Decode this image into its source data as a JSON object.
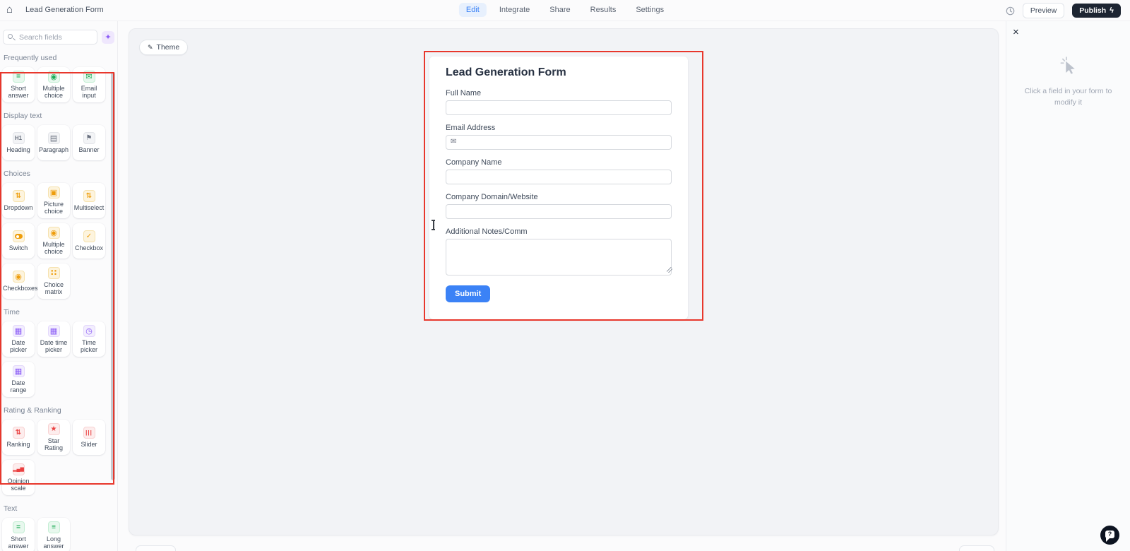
{
  "topbar": {
    "title": "Lead Generation Form",
    "nav": [
      {
        "label": "Edit",
        "active": true
      },
      {
        "label": "Integrate",
        "active": false
      },
      {
        "label": "Share",
        "active": false
      },
      {
        "label": "Results",
        "active": false
      },
      {
        "label": "Settings",
        "active": false
      }
    ],
    "preview_label": "Preview",
    "publish_label": "Publish"
  },
  "sidebar": {
    "search_placeholder": "Search fields",
    "sections": [
      {
        "title": "Frequently used",
        "theme": "green",
        "items": [
          {
            "label": "Short answer",
            "icon": "short-answer-icon"
          },
          {
            "label": "Multiple choice",
            "icon": "multiple-choice-icon"
          },
          {
            "label": "Email input",
            "icon": "email-input-icon"
          }
        ]
      },
      {
        "title": "Display text",
        "theme": "gray",
        "items": [
          {
            "label": "Heading",
            "icon": "heading-icon"
          },
          {
            "label": "Paragraph",
            "icon": "paragraph-icon"
          },
          {
            "label": "Banner",
            "icon": "banner-icon"
          }
        ]
      },
      {
        "title": "Choices",
        "theme": "orange",
        "items": [
          {
            "label": "Dropdown",
            "icon": "dropdown-icon"
          },
          {
            "label": "Picture choice",
            "icon": "picture-choice-icon"
          },
          {
            "label": "Multiselect",
            "icon": "multiselect-icon"
          },
          {
            "label": "Switch",
            "icon": "switch-icon"
          },
          {
            "label": "Multiple choice",
            "icon": "multiple-choice-icon"
          },
          {
            "label": "Checkbox",
            "icon": "checkbox-icon"
          },
          {
            "label": "Checkboxes",
            "icon": "checkboxes-icon"
          },
          {
            "label": "Choice matrix",
            "icon": "choice-matrix-icon"
          }
        ]
      },
      {
        "title": "Time",
        "theme": "purple",
        "items": [
          {
            "label": "Date picker",
            "icon": "date-picker-icon"
          },
          {
            "label": "Date time picker",
            "icon": "date-time-picker-icon"
          },
          {
            "label": "Time picker",
            "icon": "time-picker-icon"
          },
          {
            "label": "Date range",
            "icon": "date-range-icon"
          }
        ]
      },
      {
        "title": "Rating & Ranking",
        "theme": "red",
        "items": [
          {
            "label": "Ranking",
            "icon": "ranking-icon"
          },
          {
            "label": "Star Rating",
            "icon": "star-rating-icon"
          },
          {
            "label": "Slider",
            "icon": "slider-icon"
          },
          {
            "label": "Opinion scale",
            "icon": "opinion-scale-icon"
          }
        ]
      },
      {
        "title": "Text",
        "theme": "green",
        "items": [
          {
            "label": "Short answer",
            "icon": "short-answer-icon"
          },
          {
            "label": "Long answer",
            "icon": "long-answer-icon"
          }
        ]
      }
    ]
  },
  "canvas": {
    "theme_label": "Theme"
  },
  "form": {
    "title": "Lead Generation Form",
    "fields": [
      {
        "label": "Full Name",
        "type": "text"
      },
      {
        "label": "Email Address",
        "type": "email"
      },
      {
        "label": "Company Name",
        "type": "text"
      },
      {
        "label": "Company Domain/Website",
        "type": "text"
      },
      {
        "label": "Additional Notes/Comm",
        "type": "textarea"
      }
    ],
    "submit_label": "Submit"
  },
  "panel": {
    "empty_text": "Click a field in your form to modify it"
  },
  "colors": {
    "accent_blue": "#3b82f6",
    "selection_red": "#e8372c",
    "publish_bg": "#1d2532",
    "group_green": "#1eab56",
    "group_gray": "#6b7280",
    "group_orange": "#ee9d0b",
    "group_purple": "#8b5cf6",
    "group_red": "#ea4040"
  }
}
